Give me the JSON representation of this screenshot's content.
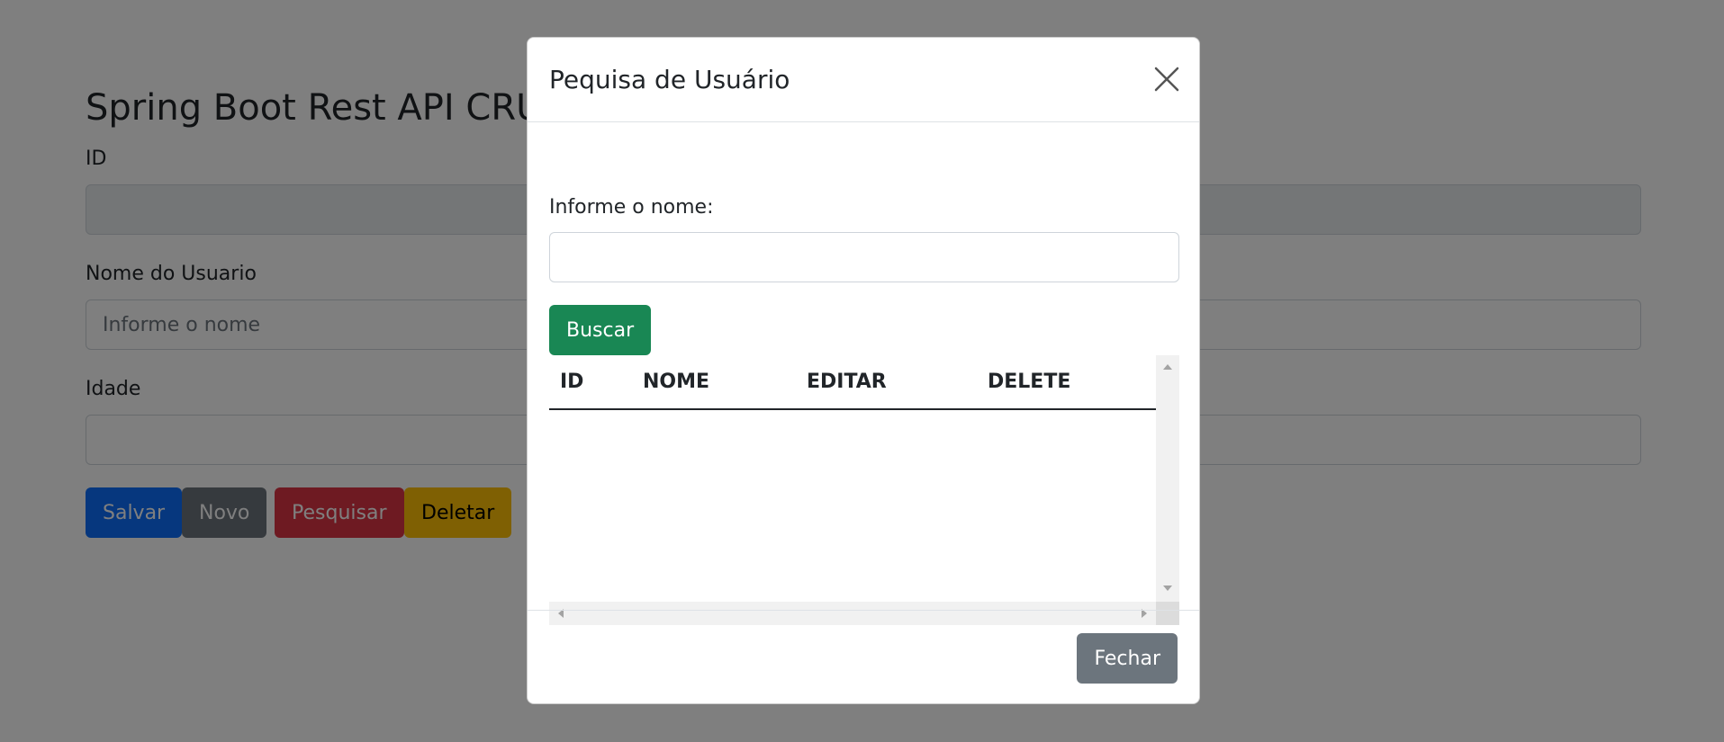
{
  "page": {
    "title": "Spring Boot Rest API CRUD",
    "fields": {
      "id": {
        "label": "ID",
        "value": ""
      },
      "name": {
        "label": "Nome do Usuario",
        "value": "",
        "placeholder": "Informe o nome"
      },
      "age": {
        "label": "Idade",
        "value": ""
      }
    },
    "buttons": {
      "save": "Salvar",
      "new": "Novo",
      "search": "Pesquisar",
      "delete": "Deletar"
    }
  },
  "modal": {
    "title": "Pequisa de Usuário",
    "close_icon": "close-x-icon",
    "search_label": "Informe o nome:",
    "search_value": "",
    "search_button": "Buscar",
    "table": {
      "columns": [
        "ID",
        "NOME",
        "EDITAR",
        "DELETE"
      ],
      "rows": []
    },
    "footer_button": "Fechar"
  },
  "colors": {
    "primary": "#0d6efd",
    "secondary": "#6c757d",
    "danger": "#dc3545",
    "warning": "#ffc107",
    "success": "#198754",
    "backdrop": "#000000"
  }
}
